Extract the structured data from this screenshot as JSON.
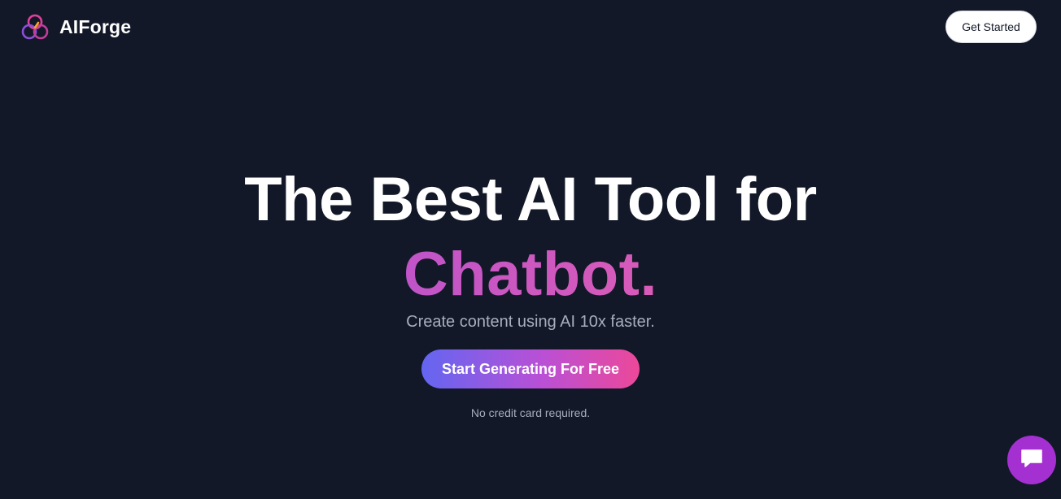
{
  "brand": {
    "name": "AIForge",
    "logo_icon": "three-rings-logo-icon",
    "colors": [
      "#e0409a",
      "#f5a623",
      "#8b4fd8"
    ]
  },
  "nav": {
    "cta_label": "Get Started"
  },
  "hero": {
    "headline": "The Best AI Tool for",
    "headline_accent": "Chatbot.",
    "subheadline": "Create content using AI 10x faster.",
    "cta_label": "Start Generating For Free",
    "fine_print": "No credit card required."
  },
  "chat_widget": {
    "icon": "chat-bubble-icon",
    "color": "#a530d2"
  },
  "colors": {
    "background": "#121828",
    "accent_gradient_start": "#6366f1",
    "accent_gradient_end": "#ec4899",
    "muted_text": "#a7adbb"
  }
}
